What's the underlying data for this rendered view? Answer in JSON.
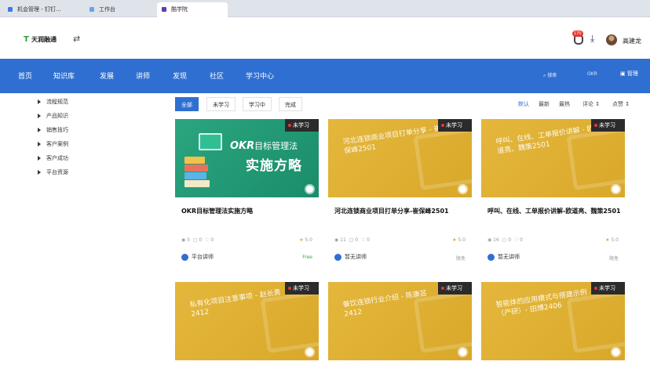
{
  "tabs": [
    {
      "label": "机会管理 - 钉钉...",
      "color": "#3d7be0"
    },
    {
      "label": "工作台",
      "color": "#6aa4e8"
    },
    {
      "label": "酷学院",
      "color": "#5a3db5"
    }
  ],
  "app": {
    "logo": "天润融通",
    "badge": "170",
    "user": "高建龙"
  },
  "nav": {
    "items": [
      "首页",
      "知识库",
      "发展",
      "讲师",
      "发现",
      "社区",
      "学习中心"
    ],
    "search": "搜索",
    "ok": "OKR",
    "manage": "管理"
  },
  "sidebar": {
    "items": [
      "流程规范",
      "产品知识",
      "销售技巧",
      "客户案例",
      "客户成功",
      "平台资源"
    ]
  },
  "filters": {
    "items": [
      "全部",
      "未学习",
      "学习中",
      "完成"
    ]
  },
  "sort": {
    "items": [
      "默认",
      "最新",
      "最热",
      "评论 ↕",
      "点赞 ↕"
    ]
  },
  "cards": [
    {
      "badge": "未学习",
      "thumb_big": "OKR",
      "thumb_big2": "目标管理法",
      "thumb_sub": "实施方略",
      "title": "OKR目标管理法实施方略",
      "views": "0",
      "comments": "0",
      "likes": "0",
      "rating": "5.0",
      "author": "平台讲师",
      "price": "Free"
    },
    {
      "badge": "未学习",
      "thumb_text": "河北连锁商业项目打单分享 - 崔保峰2501",
      "title": "河北连锁商业项目打单分享-崔保峰2501",
      "views": "11",
      "comments": "0",
      "likes": "0",
      "rating": "5.0",
      "author": "暂无讲师",
      "price": "限免"
    },
    {
      "badge": "未学习",
      "thumb_text": "呼叫、在线、工单报价讲解 - 欧道亮、魏策2501",
      "title": "呼叫、在线、工单报价讲解-欧道亮、魏策2501",
      "views": "16",
      "comments": "0",
      "likes": "0",
      "rating": "5.0",
      "author": "暂无讲师",
      "price": "限免"
    },
    {
      "badge": "未学习",
      "thumb_text": "私有化项目注意事项 - 赵长勇2412"
    },
    {
      "badge": "未学习",
      "thumb_text": "餐饮连锁行业介绍 - 陈康芸2412"
    },
    {
      "badge": "未学习",
      "thumb_text": "智能体的应用模式与搭建示例（产研）- 田博2406"
    }
  ],
  "colors": {
    "nav": "#2f6fd1",
    "thumb_gold": "#e4b73c",
    "thumb_green": "#2aa67f",
    "star": "#f1a619"
  }
}
